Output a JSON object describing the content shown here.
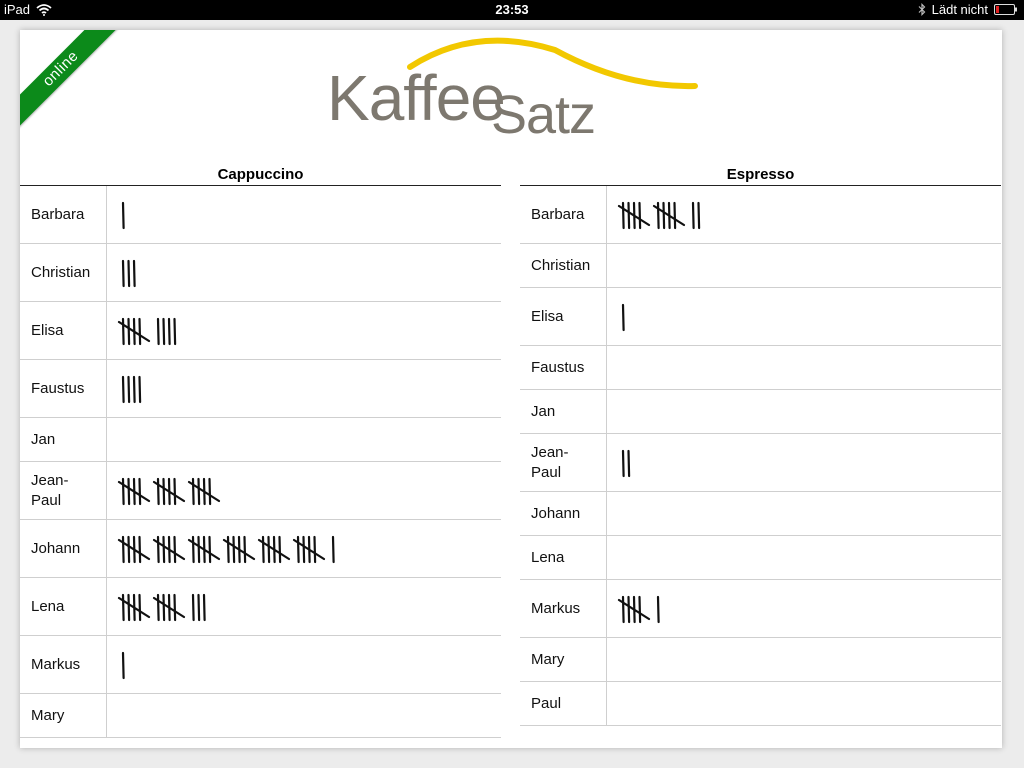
{
  "status_bar": {
    "device": "iPad",
    "time": "23:53",
    "charging": "Lädt nicht"
  },
  "ribbon": {
    "label": "online",
    "color": "#0c8a1a"
  },
  "logo": {
    "part1": "Kaffee",
    "part2": "Satz",
    "text_color": "#7d786f",
    "swoosh_color": "#f2c800"
  },
  "tables": [
    {
      "title": "Cappuccino",
      "rows": [
        {
          "name": "Barbara",
          "count": 1
        },
        {
          "name": "Christian",
          "count": 3
        },
        {
          "name": "Elisa",
          "count": 9
        },
        {
          "name": "Faustus",
          "count": 4
        },
        {
          "name": "Jan",
          "count": 0
        },
        {
          "name": "Jean-Paul",
          "count": 15
        },
        {
          "name": "Johann",
          "count": 31
        },
        {
          "name": "Lena",
          "count": 13
        },
        {
          "name": "Markus",
          "count": 1
        },
        {
          "name": "Mary",
          "count": 0
        }
      ]
    },
    {
      "title": "Espresso",
      "rows": [
        {
          "name": "Barbara",
          "count": 12
        },
        {
          "name": "Christian",
          "count": 0
        },
        {
          "name": "Elisa",
          "count": 1
        },
        {
          "name": "Faustus",
          "count": 0
        },
        {
          "name": "Jan",
          "count": 0
        },
        {
          "name": "Jean-Paul",
          "count": 2
        },
        {
          "name": "Johann",
          "count": 0
        },
        {
          "name": "Lena",
          "count": 0
        },
        {
          "name": "Markus",
          "count": 6
        },
        {
          "name": "Mary",
          "count": 0
        },
        {
          "name": "Paul",
          "count": 0
        }
      ]
    }
  ]
}
